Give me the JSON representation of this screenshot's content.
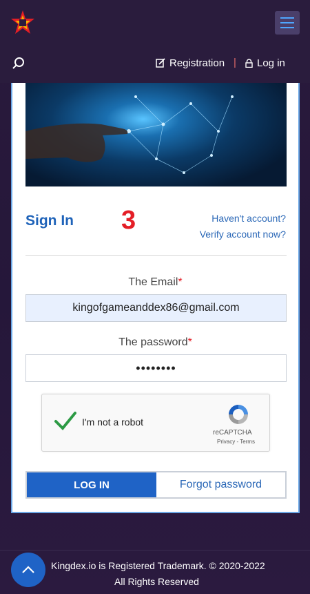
{
  "header": {
    "registration_label": "Registration",
    "separator": "|",
    "login_label": "Log in"
  },
  "signin": {
    "title": "Sign In",
    "step_number": "3",
    "link_havent_account": "Haven't account?",
    "link_verify": "Verify account now?"
  },
  "form": {
    "email_label": "The Email",
    "email_value": "kingofgameanddex86@gmail.com",
    "password_label": "The password",
    "password_value": "••••••••",
    "required_mark": "*"
  },
  "captcha": {
    "label": "I'm not a robot",
    "brand": "reCAPTCHA",
    "links": "Privacy - Terms"
  },
  "buttons": {
    "login": "LOG IN",
    "forgot": "Forgot password"
  },
  "footer": {
    "line1": "Kingdex.io is Registered Trademark. © 2020-2022",
    "line2": "All Rights Reserved"
  },
  "icons": {
    "logo": "logo-star-icon",
    "menu": "hamburger-menu-icon",
    "search": "search-icon",
    "registration": "edit-icon",
    "login": "lock-icon",
    "check": "checkmark-icon",
    "recaptcha": "recaptcha-icon",
    "scroll_top": "chevron-up-icon"
  },
  "colors": {
    "accent": "#1f63c6",
    "required": "#e41e26",
    "step": "#e41e26",
    "background": "#2a1c3d"
  }
}
